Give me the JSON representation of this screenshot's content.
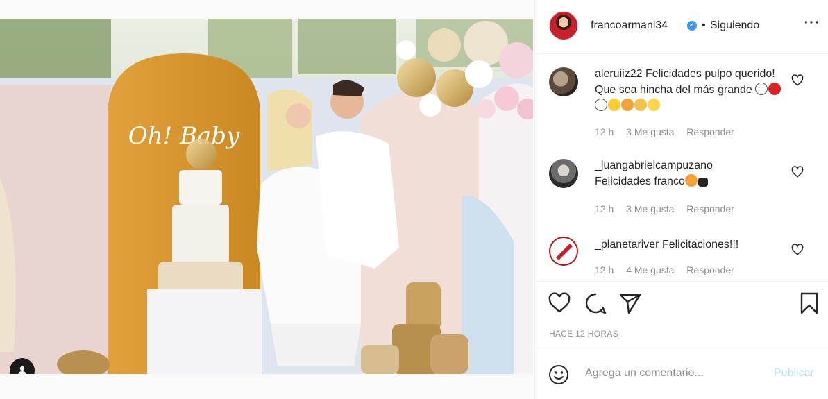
{
  "post": {
    "owner": "francoarmani34",
    "verified_glyph": "✓",
    "separator": "•",
    "follow_status": "Siguiendo",
    "more_glyph": "···",
    "time_ago": "HACE 12 HORAS",
    "photo_topper_text": "Oh! Baby"
  },
  "comments": [
    {
      "user": "aleruiiz22",
      "text": "Felicidades pulpo querido! Que sea hincha del más grande",
      "emojis": [
        "white-circle",
        "red-circle",
        "white-circle",
        "tears-of-joy-face",
        "screaming-face",
        "clapping-hands",
        "partying-face"
      ],
      "time": "12 h",
      "likes": "3 Me gusta",
      "reply": "Responder"
    },
    {
      "user": "_juangabrielcampuzano",
      "text": "Felicidades franco",
      "emojis": [
        "screaming-face",
        "black-heart"
      ],
      "time": "12 h",
      "likes": "3 Me gusta",
      "reply": "Responder"
    },
    {
      "user": "_planetariver",
      "text": "Felicitaciones!!!",
      "emojis": [],
      "time": "12 h",
      "likes": "4 Me gusta",
      "reply": "Responder"
    }
  ],
  "composer": {
    "placeholder": "Agrega un comentario...",
    "post_label": "Publicar"
  },
  "icons": {
    "like": "heart-icon",
    "comment": "comment-bubble-icon",
    "share": "paper-plane-icon",
    "save": "bookmark-icon",
    "emoji": "smiley-icon",
    "tag": "user-tag-icon"
  },
  "colors": {
    "text": "#262626",
    "muted": "#8e8e8e",
    "verified": "#3897f0",
    "publish_disabled": "#b2dffc",
    "border": "#efefef"
  }
}
